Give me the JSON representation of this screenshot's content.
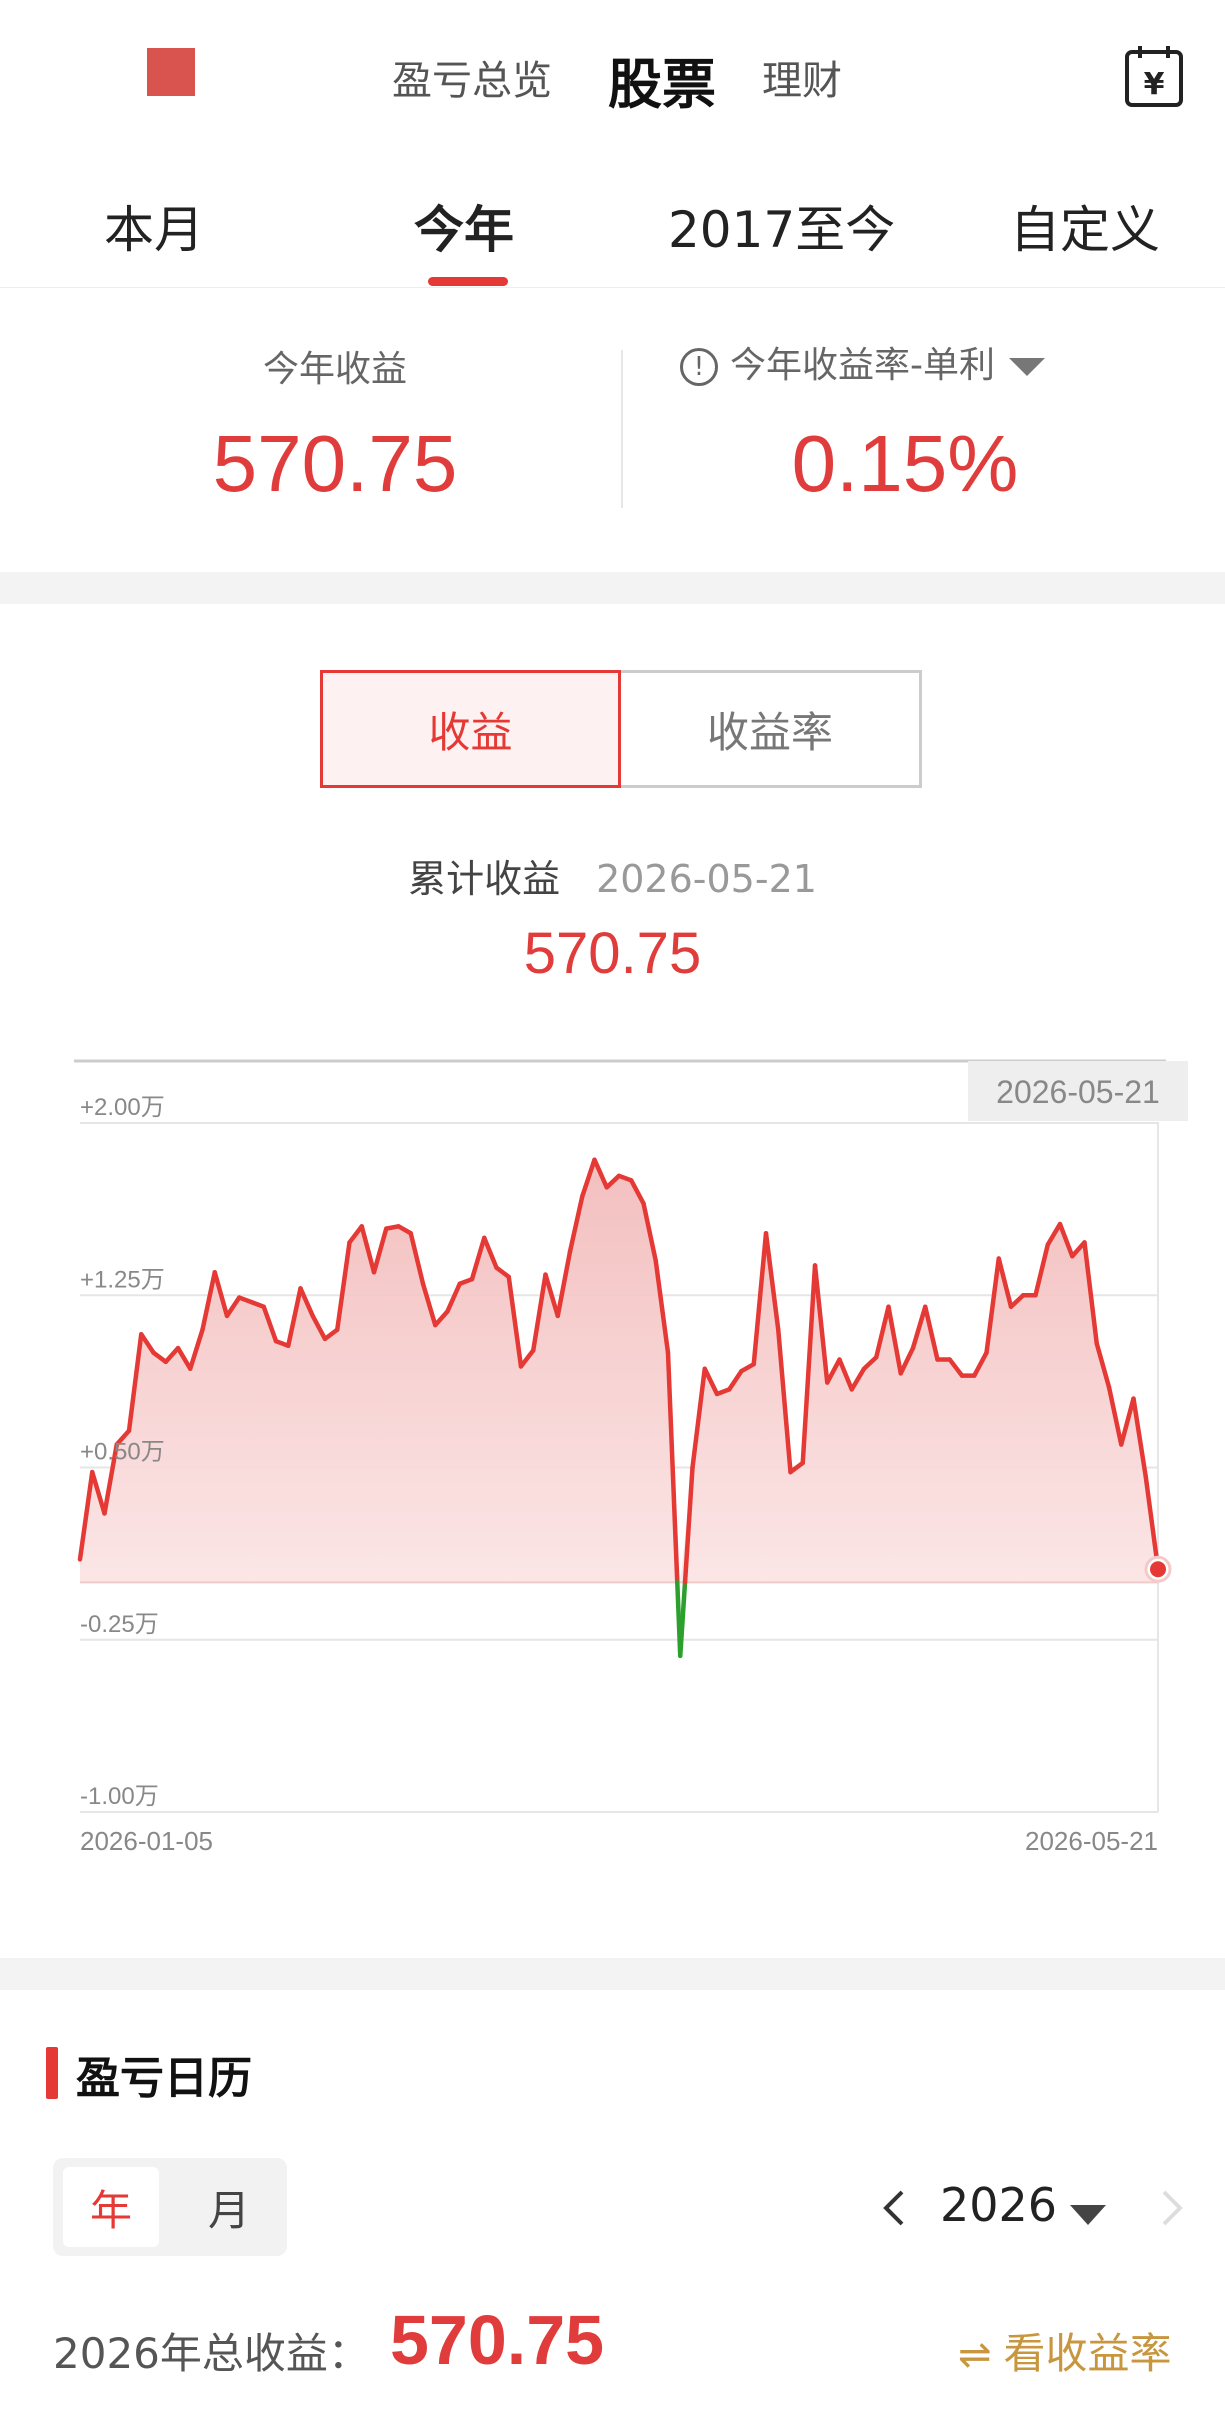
{
  "header": {
    "tabs": [
      {
        "label": "盈亏总览",
        "active": false
      },
      {
        "label": "股票",
        "active": true
      },
      {
        "label": "理财",
        "active": false
      }
    ],
    "calc_icon": "calculator-yen-icon",
    "calc_glyph": "¥"
  },
  "period_tabs": [
    {
      "label": "本月",
      "active": false
    },
    {
      "label": "今年",
      "active": true
    },
    {
      "label": "2017至今",
      "active": false
    },
    {
      "label": "自定义",
      "active": false
    }
  ],
  "summary": {
    "left_label": "今年收益",
    "left_value": "570.75",
    "right_label": "今年收益率-单利",
    "right_value": "0.15%",
    "info_glyph": "!"
  },
  "toggle": {
    "options": [
      "收益",
      "收益率"
    ],
    "active_index": 0
  },
  "cumulative": {
    "label": "累计收益",
    "date": "2026-05-21",
    "value": "570.75"
  },
  "colors": {
    "accent_red": "#e53935",
    "loss_green": "#2ca02c",
    "gold": "#c8963e"
  },
  "chart_data": {
    "type": "area",
    "x_start_label": "2026-01-05",
    "x_end_label": "2026-05-21",
    "tooltip_date": "2026-05-21",
    "ylim": [
      -1.0,
      2.0
    ],
    "y_unit": "万",
    "y_ticks": [
      2.0,
      1.25,
      0.5,
      -0.25,
      -1.0
    ],
    "y_tick_labels": [
      "+2.00万",
      "+1.25万",
      "+0.50万",
      "-0.25万",
      "-1.00万"
    ],
    "grid": true,
    "values": [
      0.1,
      0.48,
      0.3,
      0.6,
      0.66,
      1.08,
      1.0,
      0.96,
      1.02,
      0.93,
      1.1,
      1.35,
      1.16,
      1.24,
      1.22,
      1.2,
      1.05,
      1.03,
      1.28,
      1.16,
      1.06,
      1.1,
      1.48,
      1.55,
      1.35,
      1.54,
      1.55,
      1.52,
      1.3,
      1.12,
      1.18,
      1.3,
      1.32,
      1.5,
      1.37,
      1.33,
      0.94,
      1.01,
      1.34,
      1.16,
      1.44,
      1.68,
      1.84,
      1.72,
      1.77,
      1.75,
      1.65,
      1.4,
      1.0,
      -0.32,
      0.5,
      0.93,
      0.82,
      0.84,
      0.92,
      0.95,
      1.52,
      1.1,
      0.48,
      0.52,
      1.38,
      0.87,
      0.97,
      0.84,
      0.93,
      0.98,
      1.2,
      0.91,
      1.02,
      1.2,
      0.97,
      0.97,
      0.9,
      0.9,
      1.0,
      1.41,
      1.2,
      1.25,
      1.25,
      1.47,
      1.56,
      1.42,
      1.48,
      1.04,
      0.85,
      0.6,
      0.8,
      0.46,
      0.06
    ],
    "last_value": 0.057
  },
  "calendar": {
    "title": "盈亏日历",
    "seg_options": [
      "年",
      "月"
    ],
    "seg_active": 0,
    "year": "2026",
    "total_label": "2026年总收益：",
    "total_value": "570.75",
    "see_rate_label": "看收益率",
    "swap_glyph": "⇌"
  }
}
